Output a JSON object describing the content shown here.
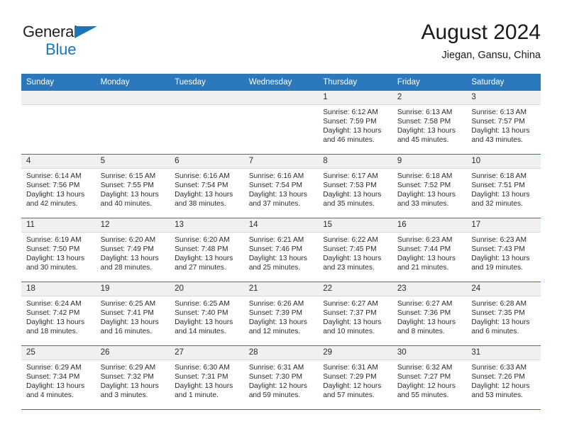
{
  "brand": {
    "name_part1": "General",
    "name_part2": "Blue",
    "triangle_color": "#1b75bb"
  },
  "header": {
    "title": "August 2024",
    "subtitle": "Jiegan, Gansu, China"
  },
  "theme": {
    "header_bg": "#2b78bd",
    "daynum_bg": "#f0f0f0",
    "text": "#2b2b2b"
  },
  "weekdays": [
    "Sunday",
    "Monday",
    "Tuesday",
    "Wednesday",
    "Thursday",
    "Friday",
    "Saturday"
  ],
  "weeks": [
    [
      {
        "day": "",
        "sunrise": "",
        "sunset": "",
        "daylight1": "",
        "daylight2": ""
      },
      {
        "day": "",
        "sunrise": "",
        "sunset": "",
        "daylight1": "",
        "daylight2": ""
      },
      {
        "day": "",
        "sunrise": "",
        "sunset": "",
        "daylight1": "",
        "daylight2": ""
      },
      {
        "day": "",
        "sunrise": "",
        "sunset": "",
        "daylight1": "",
        "daylight2": ""
      },
      {
        "day": "1",
        "sunrise": "Sunrise: 6:12 AM",
        "sunset": "Sunset: 7:59 PM",
        "daylight1": "Daylight: 13 hours",
        "daylight2": "and 46 minutes."
      },
      {
        "day": "2",
        "sunrise": "Sunrise: 6:13 AM",
        "sunset": "Sunset: 7:58 PM",
        "daylight1": "Daylight: 13 hours",
        "daylight2": "and 45 minutes."
      },
      {
        "day": "3",
        "sunrise": "Sunrise: 6:13 AM",
        "sunset": "Sunset: 7:57 PM",
        "daylight1": "Daylight: 13 hours",
        "daylight2": "and 43 minutes."
      }
    ],
    [
      {
        "day": "4",
        "sunrise": "Sunrise: 6:14 AM",
        "sunset": "Sunset: 7:56 PM",
        "daylight1": "Daylight: 13 hours",
        "daylight2": "and 42 minutes."
      },
      {
        "day": "5",
        "sunrise": "Sunrise: 6:15 AM",
        "sunset": "Sunset: 7:55 PM",
        "daylight1": "Daylight: 13 hours",
        "daylight2": "and 40 minutes."
      },
      {
        "day": "6",
        "sunrise": "Sunrise: 6:16 AM",
        "sunset": "Sunset: 7:54 PM",
        "daylight1": "Daylight: 13 hours",
        "daylight2": "and 38 minutes."
      },
      {
        "day": "7",
        "sunrise": "Sunrise: 6:16 AM",
        "sunset": "Sunset: 7:54 PM",
        "daylight1": "Daylight: 13 hours",
        "daylight2": "and 37 minutes."
      },
      {
        "day": "8",
        "sunrise": "Sunrise: 6:17 AM",
        "sunset": "Sunset: 7:53 PM",
        "daylight1": "Daylight: 13 hours",
        "daylight2": "and 35 minutes."
      },
      {
        "day": "9",
        "sunrise": "Sunrise: 6:18 AM",
        "sunset": "Sunset: 7:52 PM",
        "daylight1": "Daylight: 13 hours",
        "daylight2": "and 33 minutes."
      },
      {
        "day": "10",
        "sunrise": "Sunrise: 6:18 AM",
        "sunset": "Sunset: 7:51 PM",
        "daylight1": "Daylight: 13 hours",
        "daylight2": "and 32 minutes."
      }
    ],
    [
      {
        "day": "11",
        "sunrise": "Sunrise: 6:19 AM",
        "sunset": "Sunset: 7:50 PM",
        "daylight1": "Daylight: 13 hours",
        "daylight2": "and 30 minutes."
      },
      {
        "day": "12",
        "sunrise": "Sunrise: 6:20 AM",
        "sunset": "Sunset: 7:49 PM",
        "daylight1": "Daylight: 13 hours",
        "daylight2": "and 28 minutes."
      },
      {
        "day": "13",
        "sunrise": "Sunrise: 6:20 AM",
        "sunset": "Sunset: 7:48 PM",
        "daylight1": "Daylight: 13 hours",
        "daylight2": "and 27 minutes."
      },
      {
        "day": "14",
        "sunrise": "Sunrise: 6:21 AM",
        "sunset": "Sunset: 7:46 PM",
        "daylight1": "Daylight: 13 hours",
        "daylight2": "and 25 minutes."
      },
      {
        "day": "15",
        "sunrise": "Sunrise: 6:22 AM",
        "sunset": "Sunset: 7:45 PM",
        "daylight1": "Daylight: 13 hours",
        "daylight2": "and 23 minutes."
      },
      {
        "day": "16",
        "sunrise": "Sunrise: 6:23 AM",
        "sunset": "Sunset: 7:44 PM",
        "daylight1": "Daylight: 13 hours",
        "daylight2": "and 21 minutes."
      },
      {
        "day": "17",
        "sunrise": "Sunrise: 6:23 AM",
        "sunset": "Sunset: 7:43 PM",
        "daylight1": "Daylight: 13 hours",
        "daylight2": "and 19 minutes."
      }
    ],
    [
      {
        "day": "18",
        "sunrise": "Sunrise: 6:24 AM",
        "sunset": "Sunset: 7:42 PM",
        "daylight1": "Daylight: 13 hours",
        "daylight2": "and 18 minutes."
      },
      {
        "day": "19",
        "sunrise": "Sunrise: 6:25 AM",
        "sunset": "Sunset: 7:41 PM",
        "daylight1": "Daylight: 13 hours",
        "daylight2": "and 16 minutes."
      },
      {
        "day": "20",
        "sunrise": "Sunrise: 6:25 AM",
        "sunset": "Sunset: 7:40 PM",
        "daylight1": "Daylight: 13 hours",
        "daylight2": "and 14 minutes."
      },
      {
        "day": "21",
        "sunrise": "Sunrise: 6:26 AM",
        "sunset": "Sunset: 7:39 PM",
        "daylight1": "Daylight: 13 hours",
        "daylight2": "and 12 minutes."
      },
      {
        "day": "22",
        "sunrise": "Sunrise: 6:27 AM",
        "sunset": "Sunset: 7:37 PM",
        "daylight1": "Daylight: 13 hours",
        "daylight2": "and 10 minutes."
      },
      {
        "day": "23",
        "sunrise": "Sunrise: 6:27 AM",
        "sunset": "Sunset: 7:36 PM",
        "daylight1": "Daylight: 13 hours",
        "daylight2": "and 8 minutes."
      },
      {
        "day": "24",
        "sunrise": "Sunrise: 6:28 AM",
        "sunset": "Sunset: 7:35 PM",
        "daylight1": "Daylight: 13 hours",
        "daylight2": "and 6 minutes."
      }
    ],
    [
      {
        "day": "25",
        "sunrise": "Sunrise: 6:29 AM",
        "sunset": "Sunset: 7:34 PM",
        "daylight1": "Daylight: 13 hours",
        "daylight2": "and 4 minutes."
      },
      {
        "day": "26",
        "sunrise": "Sunrise: 6:29 AM",
        "sunset": "Sunset: 7:32 PM",
        "daylight1": "Daylight: 13 hours",
        "daylight2": "and 3 minutes."
      },
      {
        "day": "27",
        "sunrise": "Sunrise: 6:30 AM",
        "sunset": "Sunset: 7:31 PM",
        "daylight1": "Daylight: 13 hours",
        "daylight2": "and 1 minute."
      },
      {
        "day": "28",
        "sunrise": "Sunrise: 6:31 AM",
        "sunset": "Sunset: 7:30 PM",
        "daylight1": "Daylight: 12 hours",
        "daylight2": "and 59 minutes."
      },
      {
        "day": "29",
        "sunrise": "Sunrise: 6:31 AM",
        "sunset": "Sunset: 7:29 PM",
        "daylight1": "Daylight: 12 hours",
        "daylight2": "and 57 minutes."
      },
      {
        "day": "30",
        "sunrise": "Sunrise: 6:32 AM",
        "sunset": "Sunset: 7:27 PM",
        "daylight1": "Daylight: 12 hours",
        "daylight2": "and 55 minutes."
      },
      {
        "day": "31",
        "sunrise": "Sunrise: 6:33 AM",
        "sunset": "Sunset: 7:26 PM",
        "daylight1": "Daylight: 12 hours",
        "daylight2": "and 53 minutes."
      }
    ]
  ]
}
